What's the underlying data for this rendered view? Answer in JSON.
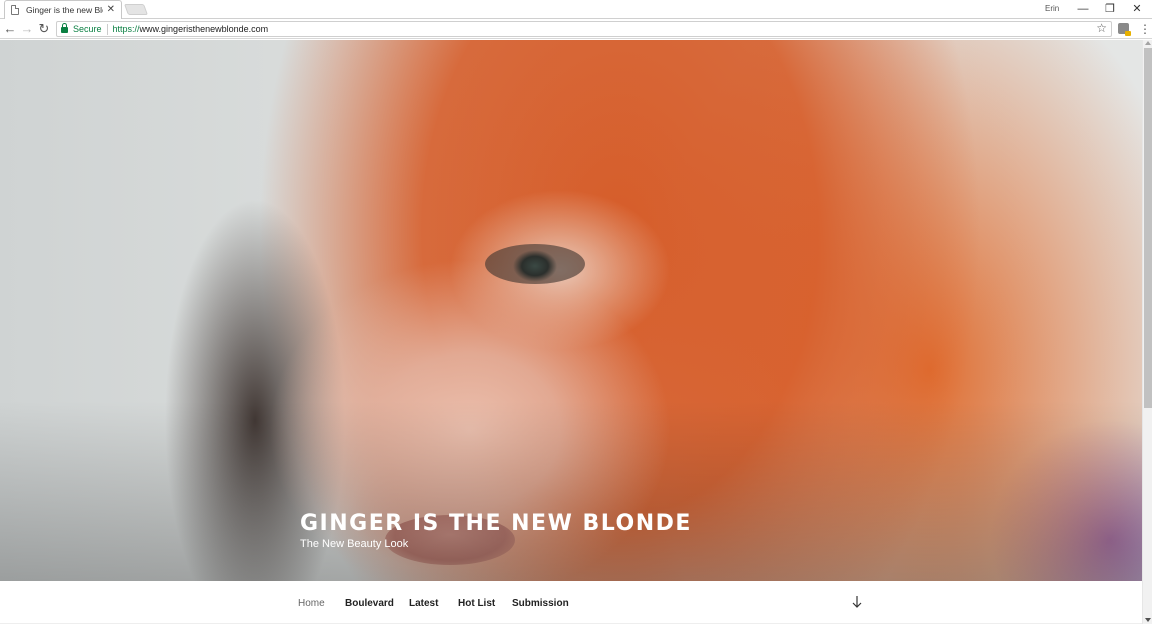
{
  "browser": {
    "tab": {
      "title": "Ginger is the new Blonde",
      "close_glyph": "✕"
    },
    "profile_name": "Erin",
    "window_controls": {
      "minimize": "—",
      "restore": "❐",
      "close": "✕"
    },
    "nav": {
      "back": "←",
      "forward": "→",
      "reload": "↻"
    },
    "omnibox": {
      "security_label": "Secure",
      "url_scheme": "https://",
      "url_host": "www.gingeristhenewblonde.com",
      "bookmark_glyph": "☆"
    },
    "menu_glyph": "⋮"
  },
  "site": {
    "title": "GINGER IS THE NEW BLONDE",
    "description": "The New Beauty Look",
    "menu": [
      {
        "label": "Home",
        "current": true
      },
      {
        "label": "Boulevard",
        "current": false
      },
      {
        "label": "Latest",
        "current": false
      },
      {
        "label": "Hot List",
        "current": false
      },
      {
        "label": "Submission",
        "current": false
      }
    ]
  },
  "colors": {
    "secure_green": "#0b8043",
    "hair_orange": "#d65620",
    "nav_text": "#222222",
    "nav_current": "#666666"
  },
  "icons": [
    "page-favicon",
    "back-arrow-icon",
    "forward-arrow-icon",
    "reload-icon",
    "lock-icon",
    "star-icon",
    "extension-icon",
    "menu-icon",
    "arrow-down-icon"
  ]
}
